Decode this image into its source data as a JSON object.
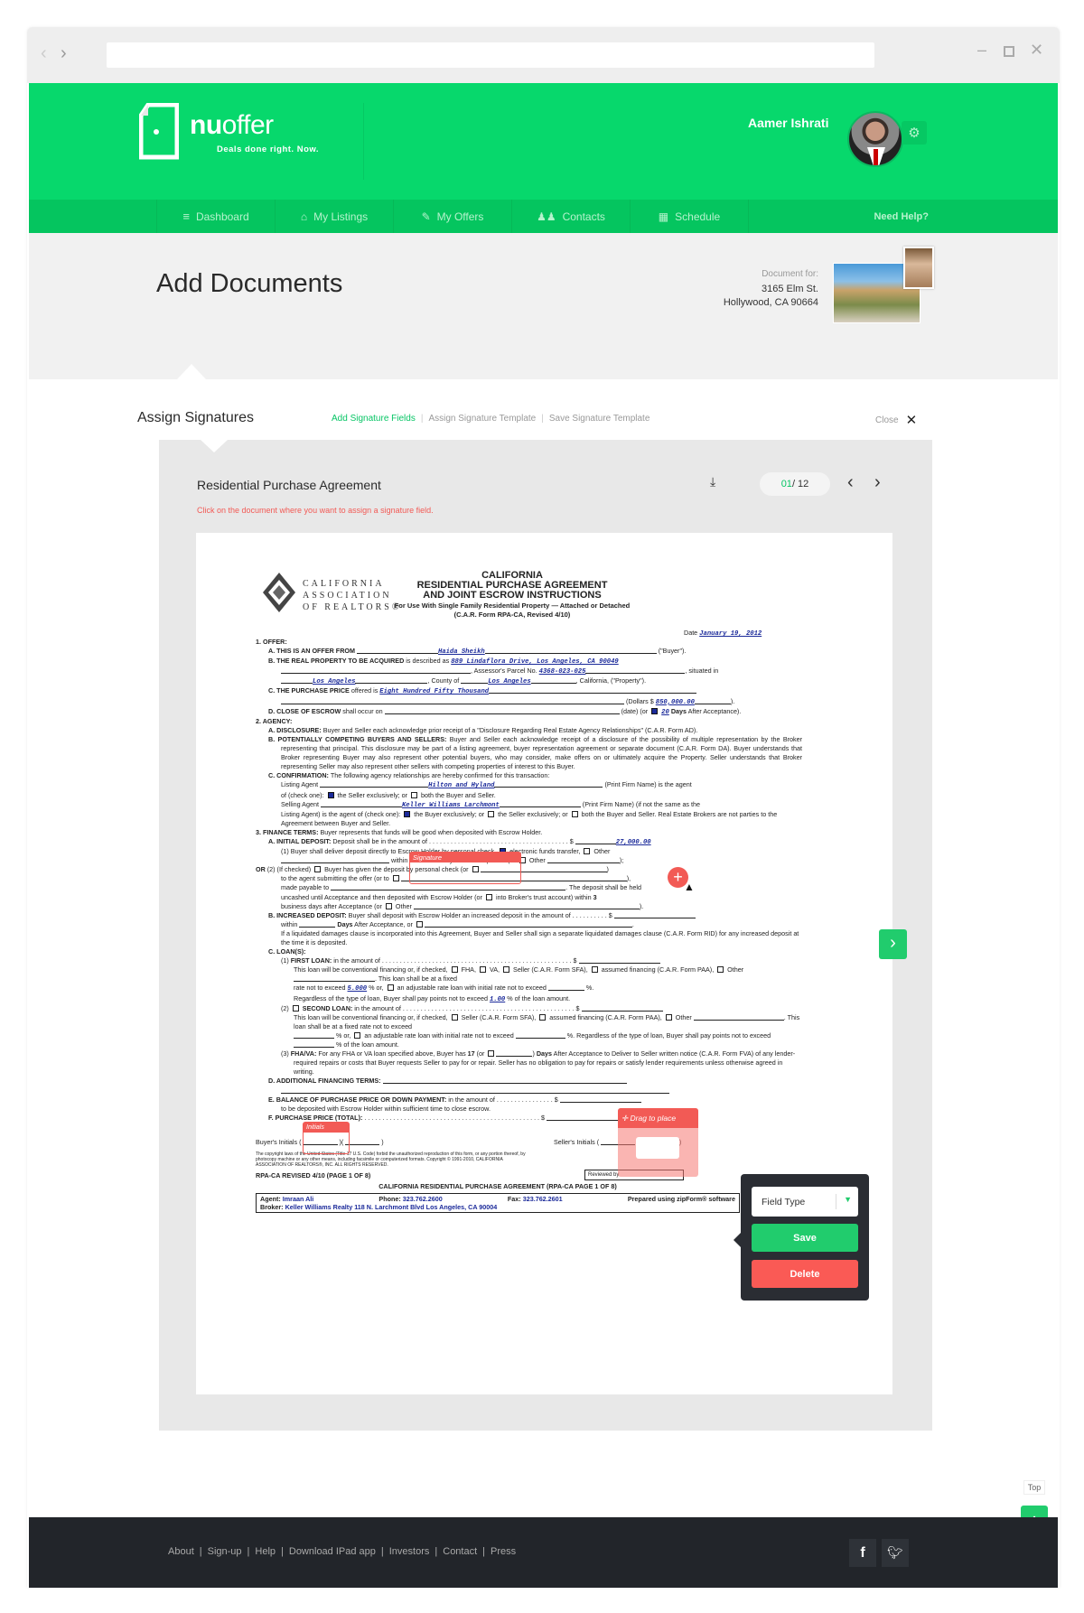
{
  "browser": {
    "back_icon": "chevron-left-icon",
    "forward_icon": "chevron-right-icon",
    "url": "",
    "controls": [
      "minimize-icon",
      "maximize-icon",
      "close-icon"
    ]
  },
  "brand": {
    "name_bold": "nu",
    "name_light": "offer",
    "tagline": "Deals done right. Now.",
    "color_primary": "#07d86c",
    "color_nav": "#05c55f",
    "color_danger": "#fa5a55",
    "color_dark": "#22252a"
  },
  "user": {
    "name": "Aamer Ishrati",
    "settings_icon": "gear-icon"
  },
  "nav": {
    "items": [
      {
        "label": "Dashboard",
        "icon": "list-icon"
      },
      {
        "label": "My Listings",
        "icon": "house-icon"
      },
      {
        "label": "My Offers",
        "icon": "edit-icon"
      },
      {
        "label": "Contacts",
        "icon": "people-icon"
      },
      {
        "label": "Schedule",
        "icon": "calendar-icon"
      }
    ],
    "help": "Need Help?"
  },
  "page": {
    "title": "Add Documents",
    "document_for_label": "Document for:",
    "address_line1": "3165 Elm St.",
    "address_line2": "Hollywood, CA 90664"
  },
  "assign": {
    "title": "Assign Signatures",
    "tabs": [
      {
        "label": "Add Signature Fields",
        "active": true
      },
      {
        "label": "Assign Signature Template",
        "active": false
      },
      {
        "label": "Save Signature Template",
        "active": false
      }
    ],
    "close_label": "Close"
  },
  "viewer": {
    "doc_title": "Residential Purchase Agreement",
    "instruction": "Click on the document where you want to assign a signature field.",
    "page_current": "01",
    "page_total": "/ 12",
    "download_icon": "download-icon"
  },
  "document": {
    "logo_lines": [
      "CALIFORNIA",
      "ASSOCIATION",
      "OF REALTORS®"
    ],
    "title_lines": [
      "CALIFORNIA",
      "RESIDENTIAL PURCHASE AGREEMENT",
      "AND JOINT ESCROW INSTRUCTIONS"
    ],
    "subtitle": "For Use With Single Family Residential Property — Attached or Detached",
    "form_id": "(C.A.R. Form RPA-CA, Revised 4/10)",
    "date_label": "Date",
    "date": "January 19, 2012",
    "buyer": "Haida Sheikh",
    "property": "889 Lindaflora Drive, Los Angeles, CA  90049",
    "parcel": "4368-023-025",
    "city": "Los Angeles",
    "county": "Los Angeles",
    "price_words": "Eight Hundred Fifty Thousand",
    "price": "850,000.00",
    "close_days": "20",
    "listing_agent": "Hilton and Hyland",
    "selling_agent": "Keller Williams Larchmont",
    "initial_deposit": "27,000.00",
    "fixed_rate": "5.000",
    "points": "1.00",
    "footer_title": "CALIFORNIA RESIDENTIAL PURCHASE AGREEMENT (RPA-CA PAGE 1 OF 8)",
    "revised": "RPA-CA REVISED 4/10 (PAGE 1 OF 8)",
    "copyright": "The copyright laws of the United States (Title 17 U.S. Code) forbid the unauthorized reproduction of this form, or any portion thereof, by photocopy machine or any other means, including facsimile or computerized formats. Copyright © 1991-2010, CALIFORNIA ASSOCIATION OF REALTORS®, INC. ALL RIGHTS RESERVED.",
    "agent": "Imraan Ali",
    "phone": "323.762.2600",
    "fax": "323.762.2601",
    "prepared": "Prepared using zipForm® software",
    "broker": "Keller Williams Realty 118 N. Larchmont Blvd Los Angeles, CA 90004",
    "reviewed_by": "Reviewed by",
    "buyers_initials": "Buyer's Initials",
    "sellers_initials": "Seller's Initials"
  },
  "fields": {
    "signature_label": "Signature",
    "initials_label": "Initials",
    "drag_label": "Drag to place"
  },
  "popup": {
    "field_type": "Field Type",
    "save": "Save",
    "delete": "Delete"
  },
  "scroll_top": {
    "tooltip": "Top"
  },
  "footer": {
    "links": [
      "About",
      "Sign-up",
      "Help",
      "Download IPad app",
      "Investors",
      "Contact",
      "Press"
    ],
    "social": [
      "facebook-icon",
      "twitter-icon"
    ]
  }
}
